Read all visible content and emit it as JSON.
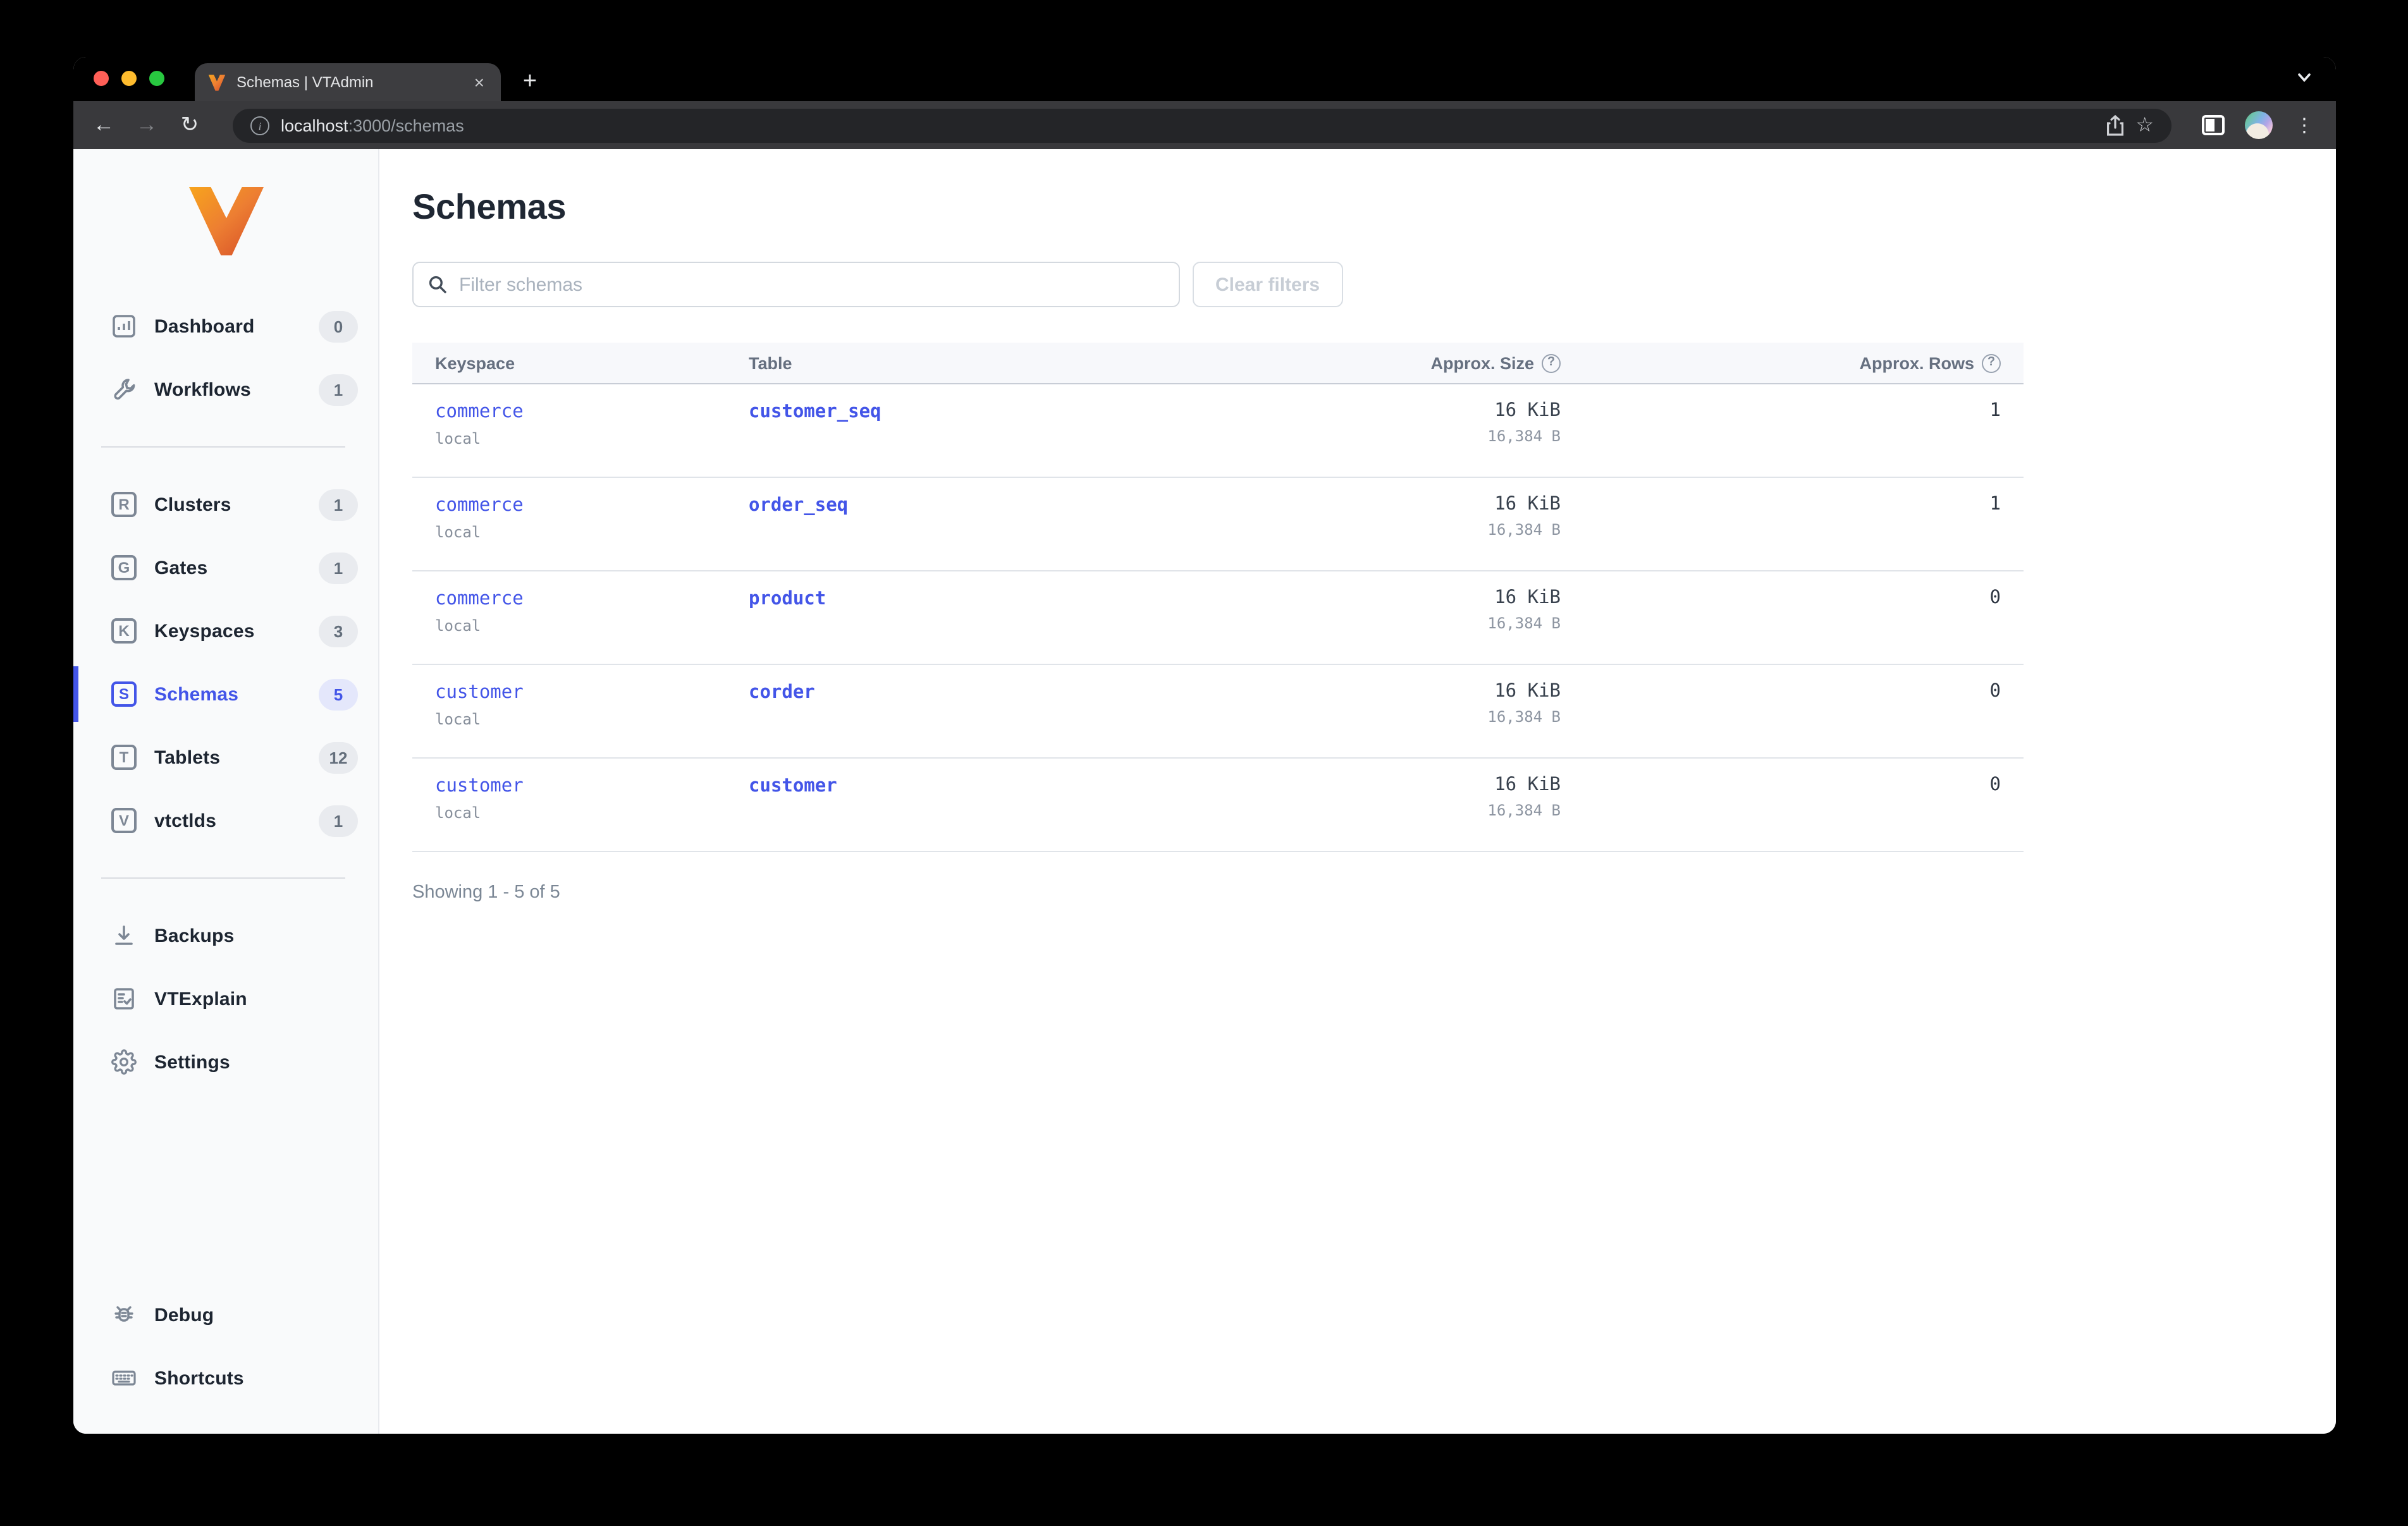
{
  "colors": {
    "primary": "#4355e8",
    "link": "#4355e8",
    "traffic_red": "#ff5f57",
    "traffic_yellow": "#febc2e",
    "traffic_green": "#28c840"
  },
  "icons": {
    "close_glyph": "×",
    "plus_glyph": "+",
    "kebab_glyph": "⋮",
    "star_glyph": "☆",
    "info_glyph": "i",
    "help_glyph": "?",
    "back_glyph": "←",
    "forward_glyph": "→",
    "reload_glyph": "↻"
  },
  "browser": {
    "tab_title": "Schemas | VTAdmin",
    "url_host": "localhost",
    "url_rest": ":3000/schemas"
  },
  "sidebar": {
    "items": [
      {
        "label": "Dashboard",
        "count": "0"
      },
      {
        "label": "Workflows",
        "count": "1"
      },
      {
        "label": "Clusters",
        "count": "1",
        "letter": "R"
      },
      {
        "label": "Gates",
        "count": "1",
        "letter": "G"
      },
      {
        "label": "Keyspaces",
        "count": "3",
        "letter": "K"
      },
      {
        "label": "Schemas",
        "count": "5",
        "letter": "S"
      },
      {
        "label": "Tablets",
        "count": "12",
        "letter": "T"
      },
      {
        "label": "vtctlds",
        "count": "1",
        "letter": "V"
      },
      {
        "label": "Backups"
      },
      {
        "label": "VTExplain"
      },
      {
        "label": "Settings"
      },
      {
        "label": "Debug"
      },
      {
        "label": "Shortcuts"
      }
    ]
  },
  "main": {
    "title": "Schemas",
    "filter_placeholder": "Filter schemas",
    "clear_button": "Clear filters",
    "table": {
      "headers": [
        "Keyspace",
        "Table",
        "Approx. Size",
        "Approx. Rows"
      ],
      "rows": [
        {
          "keyspace": "commerce",
          "cluster": "local",
          "table": "customer_seq",
          "size": "16 KiB",
          "size_bytes": "16,384 B",
          "rows": "1"
        },
        {
          "keyspace": "commerce",
          "cluster": "local",
          "table": "order_seq",
          "size": "16 KiB",
          "size_bytes": "16,384 B",
          "rows": "1"
        },
        {
          "keyspace": "commerce",
          "cluster": "local",
          "table": "product",
          "size": "16 KiB",
          "size_bytes": "16,384 B",
          "rows": "0"
        },
        {
          "keyspace": "customer",
          "cluster": "local",
          "table": "corder",
          "size": "16 KiB",
          "size_bytes": "16,384 B",
          "rows": "0"
        },
        {
          "keyspace": "customer",
          "cluster": "local",
          "table": "customer",
          "size": "16 KiB",
          "size_bytes": "16,384 B",
          "rows": "0"
        }
      ]
    },
    "summary": "Showing 1 - 5 of 5"
  }
}
